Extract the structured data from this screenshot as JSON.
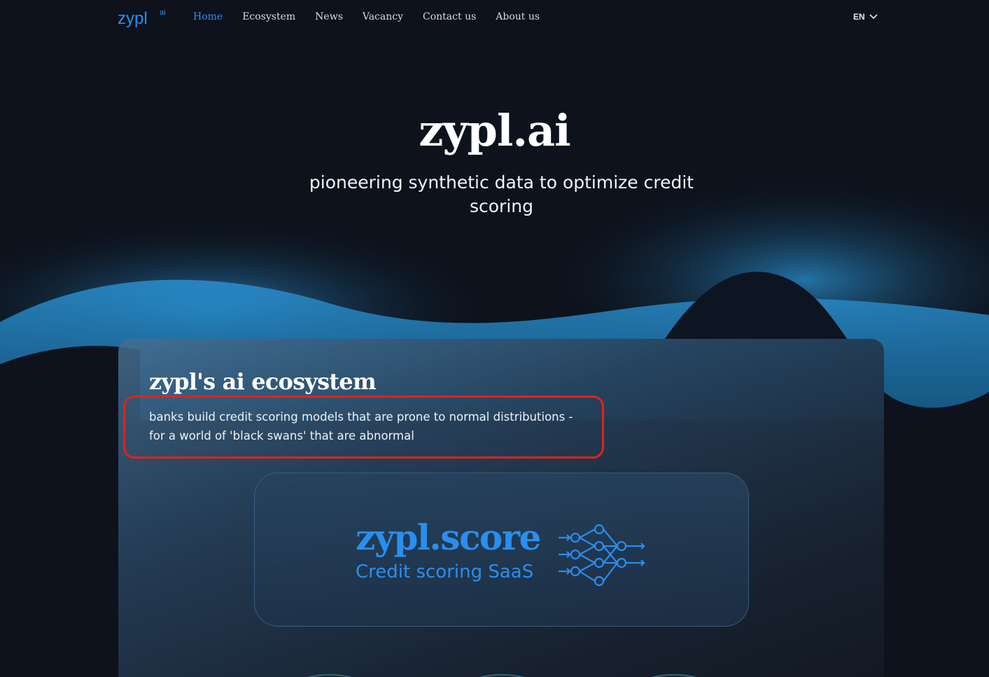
{
  "nav": {
    "logo_text": "zypl",
    "logo_sup": "ai",
    "links": [
      {
        "label": "Home",
        "active": true
      },
      {
        "label": "Ecosystem",
        "active": false
      },
      {
        "label": "News",
        "active": false
      },
      {
        "label": "Vacancy",
        "active": false
      },
      {
        "label": "Contact us",
        "active": false
      },
      {
        "label": "About us",
        "active": false
      }
    ],
    "language": "EN"
  },
  "hero": {
    "title": "zypl.ai",
    "subtitle": "pioneering synthetic data to optimize credit scoring"
  },
  "ecosystem": {
    "title": "zypl's ai ecosystem",
    "description": "banks build credit scoring models that are prone to normal distributions - for a world of 'black swans' that are abnormal",
    "product": {
      "name": "zypl.score",
      "tagline": "Credit scoring SaaS",
      "icon": "neural-network-icon"
    }
  },
  "colors": {
    "background": "#0d121c",
    "accent": "#2a8ef0",
    "wave": "#1f7fc0",
    "highlight": "#e0231b"
  }
}
